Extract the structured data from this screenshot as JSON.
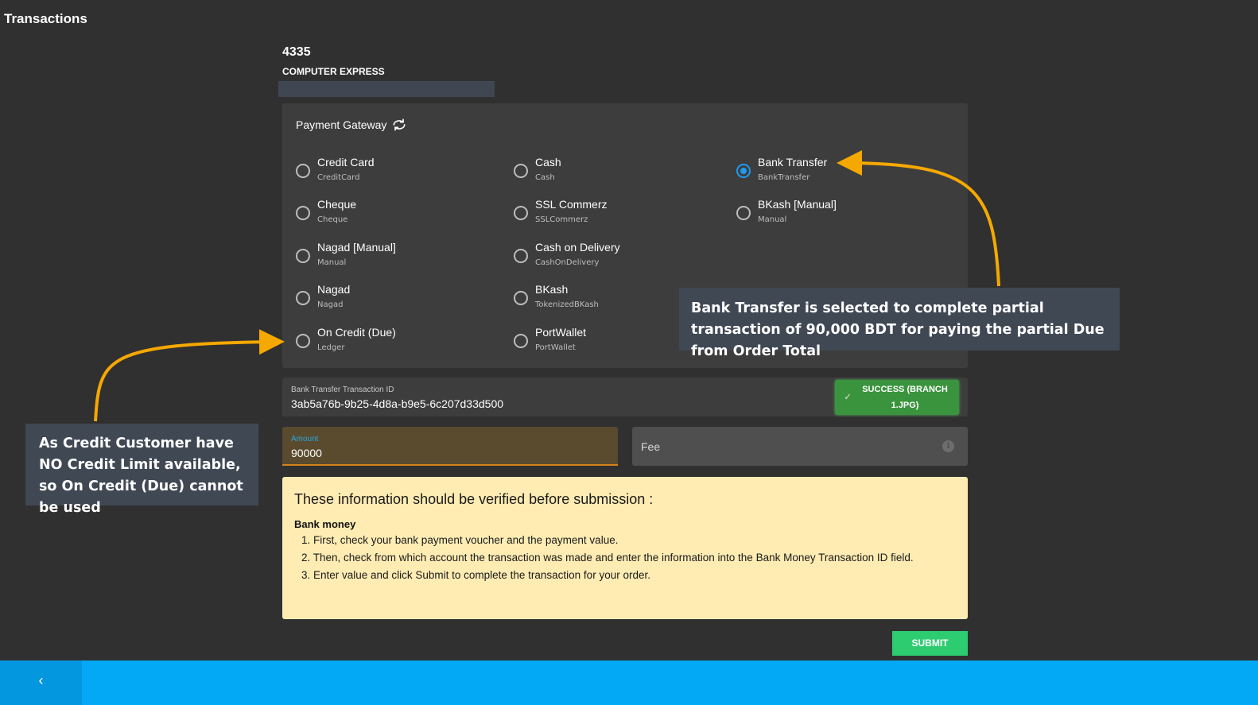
{
  "page": {
    "title": "Transactions"
  },
  "order": {
    "id": "4335",
    "customer": "COMPUTER EXPRESS"
  },
  "gateway": {
    "title": "Payment Gateway",
    "refresh_icon": "refresh-icon",
    "options": [
      {
        "label": "Credit Card",
        "sub": "CreditCard",
        "selected": false
      },
      {
        "label": "Cash",
        "sub": "Cash",
        "selected": false
      },
      {
        "label": "Bank Transfer",
        "sub": "BankTransfer",
        "selected": true
      },
      {
        "label": "Cheque",
        "sub": "Cheque",
        "selected": false
      },
      {
        "label": "SSL Commerz",
        "sub": "SSLCommerz",
        "selected": false
      },
      {
        "label": "BKash [Manual]",
        "sub": "Manual",
        "selected": false
      },
      {
        "label": "Nagad [Manual]",
        "sub": "Manual",
        "selected": false
      },
      {
        "label": "Cash on Delivery",
        "sub": "CashOnDelivery",
        "selected": false
      },
      {
        "label": "Nagad",
        "sub": "Nagad",
        "selected": false
      },
      {
        "label": "BKash",
        "sub": "TokenizedBKash",
        "selected": false
      },
      {
        "label": "On Credit (Due)",
        "sub": "Ledger",
        "selected": false
      },
      {
        "label": "PortWallet",
        "sub": "PortWallet",
        "selected": false
      }
    ]
  },
  "transaction_id": {
    "label": "Bank Transfer Transaction ID",
    "value": "3ab5a76b-9b25-4d8a-b9e5-6c207d33d500",
    "upload_status": "SUCCESS (BRANCH 1.JPG)",
    "upload_icon": "check-icon"
  },
  "amount": {
    "label": "Amount",
    "value": "90000"
  },
  "fee": {
    "label": "Fee",
    "info_icon": "info-icon"
  },
  "notice": {
    "heading": "These information should be verified before submission :",
    "subheading": "Bank money",
    "steps": [
      "1. First, check your bank payment voucher and the payment value.",
      "2. Then, check from which account the transaction was made and enter the information into the Bank Money Transaction ID field.",
      "3. Enter value and click Submit to complete the transaction for your order."
    ]
  },
  "actions": {
    "submit": "SUBMIT",
    "back_icon": "chevron-left-icon",
    "back_glyph": "‹"
  },
  "annotations": {
    "right": "Bank Transfer is selected to complete partial transaction of 90,000 BDT for paying the partial Due from Order Total",
    "left": "As Credit Customer have NO Credit Limit available, so On Credit (Due) cannot be used",
    "arrow_color": "#f5a800"
  },
  "colors": {
    "accent": "#1e9bf0",
    "success": "#3a943d",
    "submit": "#2ecc71",
    "footer": "#03a9f4",
    "notice_bg": "#ffecb3"
  }
}
